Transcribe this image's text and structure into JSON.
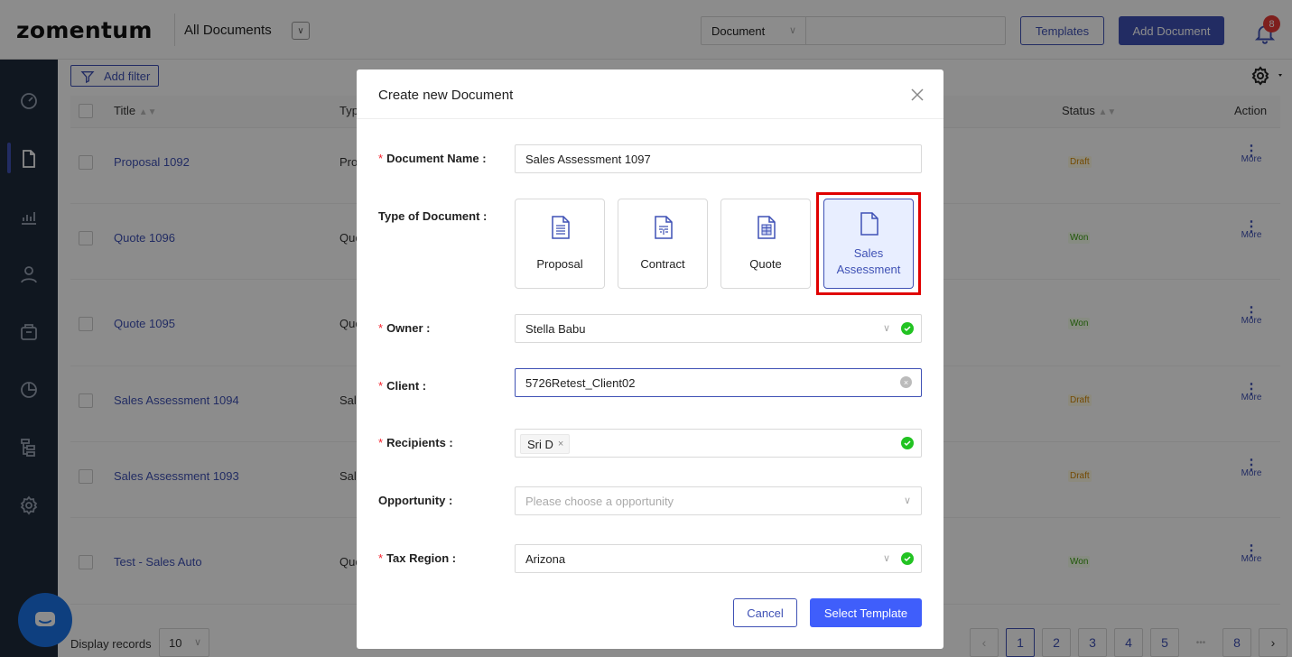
{
  "header": {
    "logo": "zomentum",
    "view_title": "All Documents",
    "search_type": "Document",
    "search_value": "",
    "templates_label": "Templates",
    "add_document_label": "Add Document",
    "notifications_count": "8"
  },
  "sidebar": {
    "items": [
      {
        "icon": "dashboard-icon"
      },
      {
        "icon": "document-icon",
        "active": true
      },
      {
        "icon": "analytics-icon"
      },
      {
        "icon": "person-icon"
      },
      {
        "icon": "box-icon"
      },
      {
        "icon": "pie-chart-icon"
      },
      {
        "icon": "hierarchy-icon"
      },
      {
        "icon": "settings-icon"
      }
    ]
  },
  "list": {
    "filter_label": "Add filter",
    "columns": {
      "title": "Title",
      "type": "Typ",
      "status": "Status",
      "action": "Action"
    },
    "rows": [
      {
        "title": "Proposal 1092",
        "type": "Pro",
        "status": "Draft",
        "more": "More"
      },
      {
        "title": "Quote 1096",
        "type": "Quo",
        "status": "Won",
        "more": "More"
      },
      {
        "title": "Quote 1095",
        "type": "Quo",
        "status": "Won",
        "more": "More"
      },
      {
        "title": "Sales Assessment 1094",
        "type": "Sal",
        "status": "Draft",
        "more": "More"
      },
      {
        "title": "Sales Assessment 1093",
        "type": "Sal",
        "status": "Draft",
        "more": "More"
      },
      {
        "title": "Test - Sales Auto",
        "type": "Quo",
        "status": "Won",
        "more": "More"
      }
    ],
    "display_records_label": "Display records",
    "display_records_value": "10",
    "pages": [
      "1",
      "2",
      "3",
      "4",
      "5",
      "8"
    ],
    "current_page": "1",
    "ellipsis": "•••"
  },
  "modal": {
    "title": "Create new Document",
    "fields": {
      "document_name": {
        "label": "Document Name :",
        "value": "Sales Assessment 1097",
        "required": true
      },
      "type_of_document": {
        "label": "Type of Document :",
        "required": false
      },
      "owner": {
        "label": "Owner :",
        "value": "Stella Babu",
        "required": true
      },
      "client": {
        "label": "Client :",
        "value": "5726Retest_Client02",
        "required": true
      },
      "recipients": {
        "label": "Recipients :",
        "tags": [
          "Sri D"
        ],
        "required": true
      },
      "opportunity": {
        "label": "Opportunity :",
        "placeholder": "Please choose a opportunity",
        "required": false
      },
      "tax_region": {
        "label": "Tax Region :",
        "value": "Arizona",
        "required": true
      }
    },
    "document_types": [
      {
        "label": "Proposal",
        "icon": "proposal-doc-icon",
        "selected": false
      },
      {
        "label": "Contract",
        "icon": "contract-doc-icon",
        "selected": false
      },
      {
        "label": "Quote",
        "icon": "quote-doc-icon",
        "selected": false
      },
      {
        "label": "Sales Assessment",
        "label_line1": "Sales",
        "label_line2": "Assessment",
        "icon": "blank-doc-icon",
        "selected": true
      }
    ],
    "cancel_label": "Cancel",
    "select_template_label": "Select Template"
  },
  "colors": {
    "primary": "#3f51b5",
    "sidebar_bg": "#1e2a3b",
    "draft": "#d48806",
    "won": "#389e0d",
    "highlight": "#e00000",
    "success": "#22c322"
  }
}
